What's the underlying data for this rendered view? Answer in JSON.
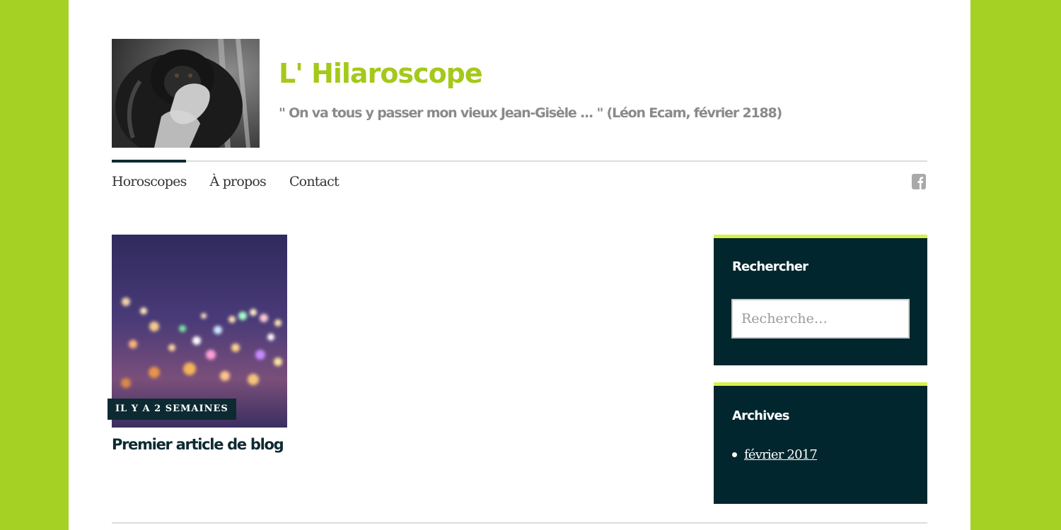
{
  "site": {
    "title": "L' Hilaroscope",
    "description": "\" On va tous y passer mon vieux Jean-Gisèle ... \" (Léon Ecam, février 2188)"
  },
  "nav": {
    "items": [
      {
        "label": "Horoscopes",
        "active": true
      },
      {
        "label": "À propos",
        "active": false
      },
      {
        "label": "Contact",
        "active": false
      }
    ],
    "social_icon": "facebook-icon"
  },
  "post": {
    "date_badge": "IL Y A 2 SEMAINES",
    "title": "Premier article de blog"
  },
  "sidebar": {
    "search": {
      "title": "Rechercher",
      "placeholder": "Recherche…",
      "value": ""
    },
    "archives": {
      "title": "Archives",
      "items": [
        "février 2017"
      ]
    }
  },
  "colors": {
    "background": "#a4d124",
    "title": "#a4c91a",
    "widget_bg": "#02262d",
    "widget_accent": "#d8f04a"
  }
}
